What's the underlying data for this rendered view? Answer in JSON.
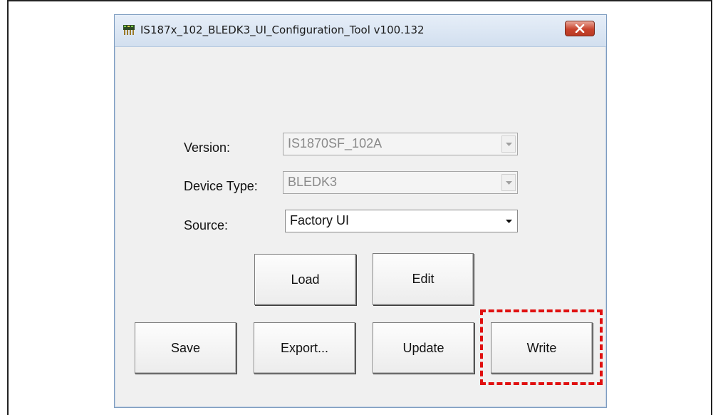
{
  "window": {
    "title": "IS187x_102_BLEDK3_UI_Configuration_Tool v100.132",
    "icons": {
      "app": "app-icon",
      "close": "close-icon"
    }
  },
  "form": {
    "version": {
      "label": "Version:",
      "value": "IS1870SF_102A",
      "enabled": false
    },
    "device_type": {
      "label": "Device Type:",
      "value": "BLEDK3",
      "enabled": false
    },
    "source": {
      "label": "Source:",
      "value": "Factory UI",
      "enabled": true
    }
  },
  "buttons": {
    "load": "Load",
    "edit": "Edit",
    "save": "Save",
    "export": "Export...",
    "update": "Update",
    "write": "Write"
  },
  "annotation": {
    "color": "#e01010",
    "style": "dashed",
    "target": "write"
  }
}
